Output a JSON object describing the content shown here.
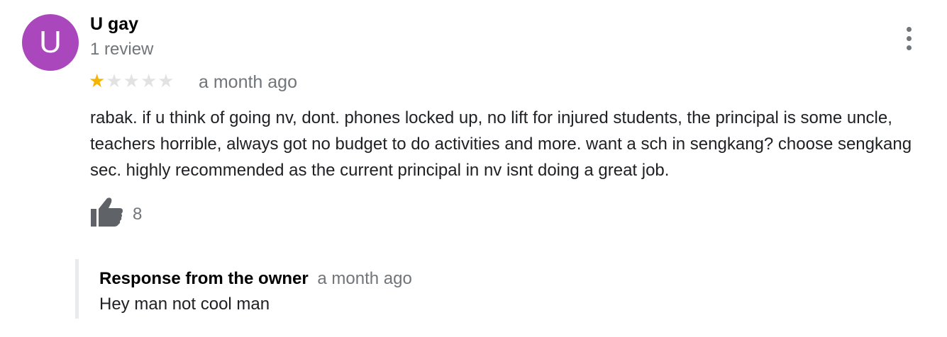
{
  "review": {
    "author": {
      "initial": "U",
      "name": "U gay",
      "review_count": "1 review",
      "avatar_color": "#ab47bc"
    },
    "rating": {
      "value": 1,
      "max": 5,
      "star_filled_color": "#f4b400",
      "star_empty_color": "#e2e2e2"
    },
    "date": "a month ago",
    "text": "rabak. if u think of going nv, dont. phones locked up, no lift for injured students, the principal is some uncle, teachers horrible, always got no budget to do activities and more. want a sch in sengkang? choose sengkang sec. highly recommended as the current principal in nv isnt doing a great job.",
    "likes": {
      "icon": "thumbs-up-icon",
      "count": "8"
    },
    "menu_icon": "more-vertical-icon",
    "owner_response": {
      "title": "Response from the owner",
      "date": "a month ago",
      "text": "Hey man not cool man"
    }
  }
}
